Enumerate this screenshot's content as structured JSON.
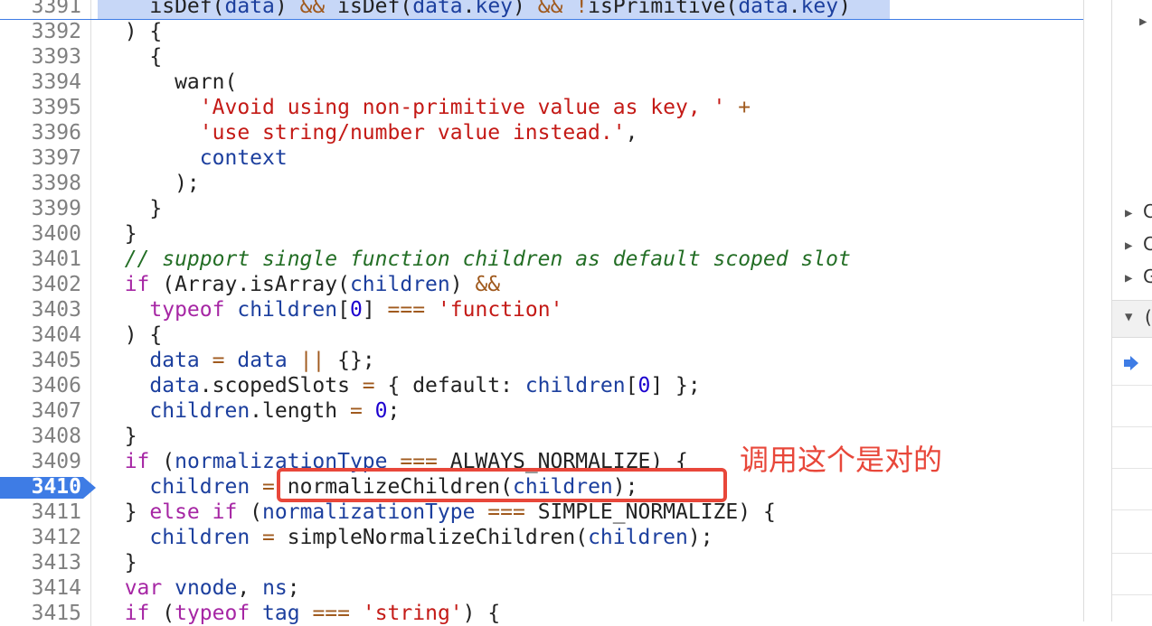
{
  "editor": {
    "highlight_color": "#c7d7f7",
    "breakpoint_color": "#3e7ce5",
    "lines": [
      {
        "n": "3391",
        "tokens": [
          [
            "fn",
            "    isDef("
          ],
          [
            "var",
            "data"
          ],
          [
            "fn",
            ") "
          ],
          [
            "op",
            "&&"
          ],
          [
            "fn",
            " isDef("
          ],
          [
            "var",
            "data"
          ],
          [
            "fn",
            "."
          ],
          [
            "var",
            "key"
          ],
          [
            "fn",
            ") "
          ],
          [
            "op",
            "&&"
          ],
          [
            "fn",
            " "
          ],
          [
            "op",
            "!"
          ],
          [
            "fn",
            "isPrimitive("
          ],
          [
            "var",
            "data"
          ],
          [
            "fn",
            "."
          ],
          [
            "var",
            "key"
          ],
          [
            "fn",
            ")"
          ]
        ]
      },
      {
        "n": "3392",
        "tokens": [
          [
            "fn",
            "  ) {"
          ]
        ]
      },
      {
        "n": "3393",
        "tokens": [
          [
            "fn",
            "    {"
          ]
        ]
      },
      {
        "n": "3394",
        "tokens": [
          [
            "fn",
            "      warn("
          ]
        ]
      },
      {
        "n": "3395",
        "tokens": [
          [
            "str",
            "        'Avoid using non-primitive value as key, '"
          ],
          [
            "fn",
            " "
          ],
          [
            "op",
            "+"
          ]
        ]
      },
      {
        "n": "3396",
        "tokens": [
          [
            "str",
            "        'use string/number value instead.'"
          ],
          [
            "fn",
            ","
          ]
        ]
      },
      {
        "n": "3397",
        "tokens": [
          [
            "fn",
            "        "
          ],
          [
            "var",
            "context"
          ]
        ]
      },
      {
        "n": "3398",
        "tokens": [
          [
            "fn",
            "      );"
          ]
        ]
      },
      {
        "n": "3399",
        "tokens": [
          [
            "fn",
            "    }"
          ]
        ]
      },
      {
        "n": "3400",
        "tokens": [
          [
            "fn",
            "  }"
          ]
        ]
      },
      {
        "n": "3401",
        "tokens": [
          [
            "cmt",
            "  // support single function children as default scoped slot"
          ]
        ]
      },
      {
        "n": "3402",
        "tokens": [
          [
            "kw",
            "  if"
          ],
          [
            "fn",
            " (Array.isArray("
          ],
          [
            "var",
            "children"
          ],
          [
            "fn",
            ") "
          ],
          [
            "op",
            "&&"
          ]
        ]
      },
      {
        "n": "3403",
        "tokens": [
          [
            "kw",
            "    typeof"
          ],
          [
            "fn",
            " "
          ],
          [
            "var",
            "children"
          ],
          [
            "fn",
            "["
          ],
          [
            "num",
            "0"
          ],
          [
            "fn",
            "] "
          ],
          [
            "op",
            "==="
          ],
          [
            "fn",
            " "
          ],
          [
            "str",
            "'function'"
          ]
        ]
      },
      {
        "n": "3404",
        "tokens": [
          [
            "fn",
            "  ) {"
          ]
        ]
      },
      {
        "n": "3405",
        "tokens": [
          [
            "fn",
            "    "
          ],
          [
            "var",
            "data"
          ],
          [
            "fn",
            " "
          ],
          [
            "op",
            "="
          ],
          [
            "fn",
            " "
          ],
          [
            "var",
            "data"
          ],
          [
            "fn",
            " "
          ],
          [
            "op",
            "||"
          ],
          [
            "fn",
            " {};"
          ]
        ]
      },
      {
        "n": "3406",
        "tokens": [
          [
            "fn",
            "    "
          ],
          [
            "var",
            "data"
          ],
          [
            "fn",
            ".scopedSlots "
          ],
          [
            "op",
            "="
          ],
          [
            "fn",
            " { default: "
          ],
          [
            "var",
            "children"
          ],
          [
            "fn",
            "["
          ],
          [
            "num",
            "0"
          ],
          [
            "fn",
            "] };"
          ]
        ]
      },
      {
        "n": "3407",
        "tokens": [
          [
            "fn",
            "    "
          ],
          [
            "var",
            "children"
          ],
          [
            "fn",
            ".length "
          ],
          [
            "op",
            "="
          ],
          [
            "fn",
            " "
          ],
          [
            "num",
            "0"
          ],
          [
            "fn",
            ";"
          ]
        ]
      },
      {
        "n": "3408",
        "tokens": [
          [
            "fn",
            "  }"
          ]
        ]
      },
      {
        "n": "3409",
        "tokens": [
          [
            "kw",
            "  if"
          ],
          [
            "fn",
            " ("
          ],
          [
            "var",
            "normalizationType"
          ],
          [
            "fn",
            " "
          ],
          [
            "op",
            "==="
          ],
          [
            "fn",
            " ALWAYS_NORMALIZE) {"
          ]
        ]
      },
      {
        "n": "3410",
        "tokens": [
          [
            "fn",
            "    "
          ],
          [
            "var",
            "children"
          ],
          [
            "fn",
            " "
          ],
          [
            "op",
            "="
          ],
          [
            "fn",
            " normalizeChildren("
          ],
          [
            "var",
            "children"
          ],
          [
            "fn",
            ");"
          ]
        ]
      },
      {
        "n": "3411",
        "tokens": [
          [
            "fn",
            "  } "
          ],
          [
            "kw",
            "else if"
          ],
          [
            "fn",
            " ("
          ],
          [
            "var",
            "normalizationType"
          ],
          [
            "fn",
            " "
          ],
          [
            "op",
            "==="
          ],
          [
            "fn",
            " SIMPLE_NORMALIZE) {"
          ]
        ]
      },
      {
        "n": "3412",
        "tokens": [
          [
            "fn",
            "    "
          ],
          [
            "var",
            "children"
          ],
          [
            "fn",
            " "
          ],
          [
            "op",
            "="
          ],
          [
            "fn",
            " simpleNormalizeChildren("
          ],
          [
            "var",
            "children"
          ],
          [
            "fn",
            ");"
          ]
        ]
      },
      {
        "n": "3413",
        "tokens": [
          [
            "fn",
            "  }"
          ]
        ]
      },
      {
        "n": "3414",
        "tokens": [
          [
            "kw",
            "  var"
          ],
          [
            "fn",
            " "
          ],
          [
            "var",
            "vnode"
          ],
          [
            "fn",
            ", "
          ],
          [
            "var",
            "ns"
          ],
          [
            "fn",
            ";"
          ]
        ]
      },
      {
        "n": "3415",
        "tokens": [
          [
            "kw",
            "  if"
          ],
          [
            "fn",
            " ("
          ],
          [
            "kw",
            "typeof"
          ],
          [
            "fn",
            " "
          ],
          [
            "var",
            "tag"
          ],
          [
            "fn",
            " "
          ],
          [
            "op",
            "==="
          ],
          [
            "fn",
            " "
          ],
          [
            "str",
            "'string'"
          ],
          [
            "fn",
            ") {"
          ]
        ]
      }
    ],
    "highlighted_line": "3391",
    "breakpoint_line": "3410"
  },
  "annotation": {
    "text": "调用这个是对的",
    "color": "#e8473a"
  },
  "sidebar": {
    "items": [
      {
        "label": "C",
        "icon": "triangle-right"
      },
      {
        "label": "C",
        "icon": "triangle-right"
      },
      {
        "label": "G",
        "icon": "triangle-right"
      }
    ],
    "header_label": "(",
    "active_icon": "arrow-right-icon"
  }
}
